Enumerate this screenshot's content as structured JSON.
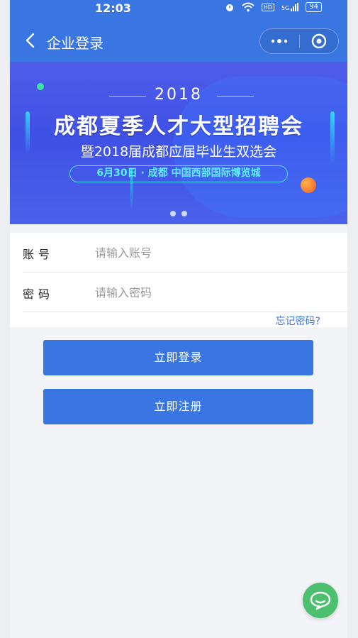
{
  "status_bar": {
    "time": "12:03",
    "battery": "94",
    "network": "5G",
    "hd": "HD"
  },
  "nav": {
    "title": "企业登录",
    "back_icon": "chevron-left-icon",
    "more_icon": "more-dots-icon",
    "close_icon": "target-circle-icon"
  },
  "banner": {
    "year": "2018",
    "headline": "成都夏季人才大型招聘会",
    "subtitle": "暨2018届成都应届毕业生双选会",
    "date_venue": "6月30日 · 成都 中国西部国际博览城",
    "slides_count": 2,
    "active_slide": 1
  },
  "form": {
    "account_label": "账号",
    "account_placeholder": "请输入账号",
    "password_label": "密码",
    "password_placeholder": "请输入密码",
    "forgot_label": "忘记密码?"
  },
  "actions": {
    "login_label": "立即登录",
    "register_label": "立即注册"
  },
  "float": {
    "chat_icon": "chat-bubble-icon"
  },
  "colors": {
    "primary": "#3a76e1",
    "chat_green": "#4cc06f",
    "banner_blue": "#4f5de8",
    "accent_cyan": "#49e2ff"
  }
}
